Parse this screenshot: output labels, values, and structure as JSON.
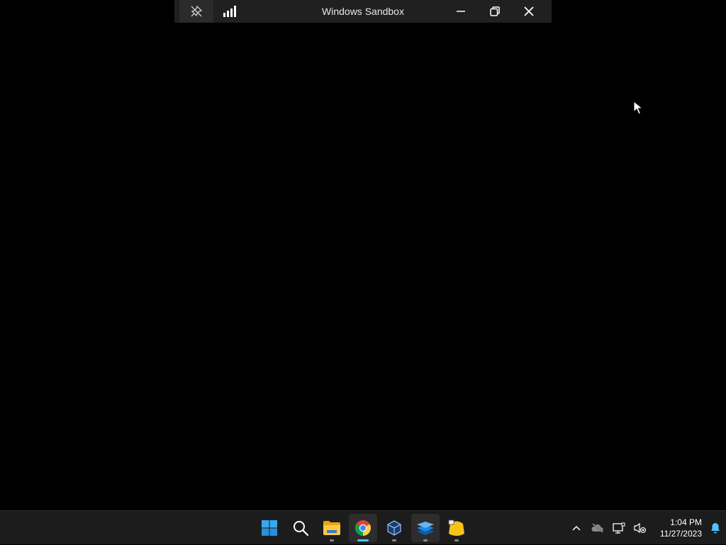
{
  "connection_bar": {
    "title": "Windows Sandbox",
    "pin_icon": "unpin-icon",
    "signal_icon": "connection-quality-icon",
    "minimize_icon": "minimize-icon",
    "restore_icon": "restore-icon",
    "close_icon": "close-icon"
  },
  "taskbar": {
    "apps": [
      {
        "name": "start",
        "icon": "windows-start-icon"
      },
      {
        "name": "search",
        "icon": "search-icon"
      },
      {
        "name": "file-explorer",
        "icon": "folder-icon"
      },
      {
        "name": "chrome",
        "icon": "chrome-icon"
      },
      {
        "name": "virtualbox",
        "icon": "virtualbox-icon"
      },
      {
        "name": "app-stack",
        "icon": "stack-icon"
      },
      {
        "name": "sticky-app",
        "icon": "yellow-app-icon"
      }
    ],
    "tray": {
      "chevron_icon": "chevron-up-icon",
      "onedrive_icon": "cloud-offline-icon",
      "network_icon": "network-icon",
      "volume_icon": "volume-muted-icon",
      "notification_icon": "bell-icon"
    },
    "clock": {
      "time": "1:04 PM",
      "date": "11/27/2023"
    }
  },
  "colors": {
    "desktop": "#000000",
    "taskbar": "#1c1c1c",
    "accent": "#4cc2ff"
  }
}
